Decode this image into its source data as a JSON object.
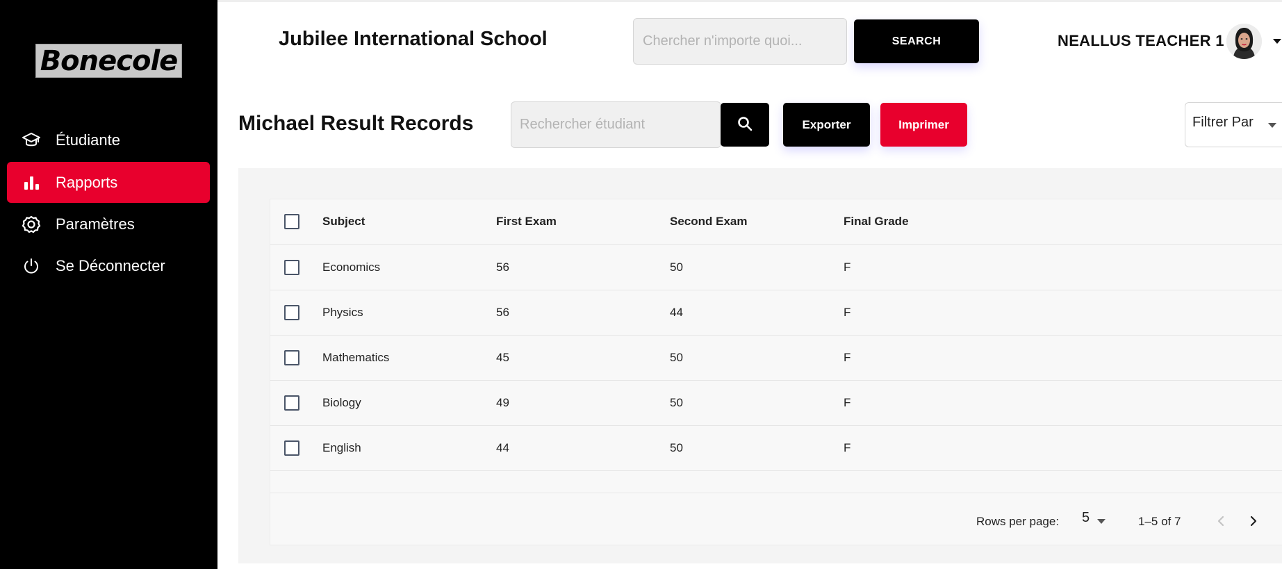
{
  "sidebar": {
    "logo_text": "Bonecole",
    "items": [
      {
        "label": "Étudiante",
        "icon": "graduation-cap-icon",
        "active": false
      },
      {
        "label": "Rapports",
        "icon": "bar-chart-icon",
        "active": true
      },
      {
        "label": "Paramètres",
        "icon": "gear-icon",
        "active": false
      },
      {
        "label": "Se Déconnecter",
        "icon": "power-icon",
        "active": false
      }
    ]
  },
  "header": {
    "school_name": "Jubilee International School",
    "search_placeholder": "Chercher n'importe quoi...",
    "search_button": "SEARCH",
    "user_name": "NEALLUS TEACHER 1"
  },
  "page": {
    "title": "Michael Result Records",
    "student_search_placeholder": "Rechercher étudiant",
    "export_label": "Exporter",
    "print_label": "Imprimer",
    "filter_label": "Filtrer Par"
  },
  "table": {
    "columns": [
      "Subject",
      "First Exam",
      "Second Exam",
      "Final Grade"
    ],
    "rows": [
      {
        "subject": "Economics",
        "first": "56",
        "second": "50",
        "final": "F"
      },
      {
        "subject": "Physics",
        "first": "56",
        "second": "44",
        "final": "F"
      },
      {
        "subject": "Mathematics",
        "first": "45",
        "second": "50",
        "final": "F"
      },
      {
        "subject": "Biology",
        "first": "49",
        "second": "50",
        "final": "F"
      },
      {
        "subject": "English",
        "first": "44",
        "second": "50",
        "final": "F"
      }
    ]
  },
  "pagination": {
    "rows_per_page_label": "Rows per page:",
    "rows_per_page_value": "5",
    "range": "1–5 of 7"
  },
  "colors": {
    "accent": "#e8002d",
    "sidebar_bg": "#000000",
    "button_dark": "#000000"
  }
}
